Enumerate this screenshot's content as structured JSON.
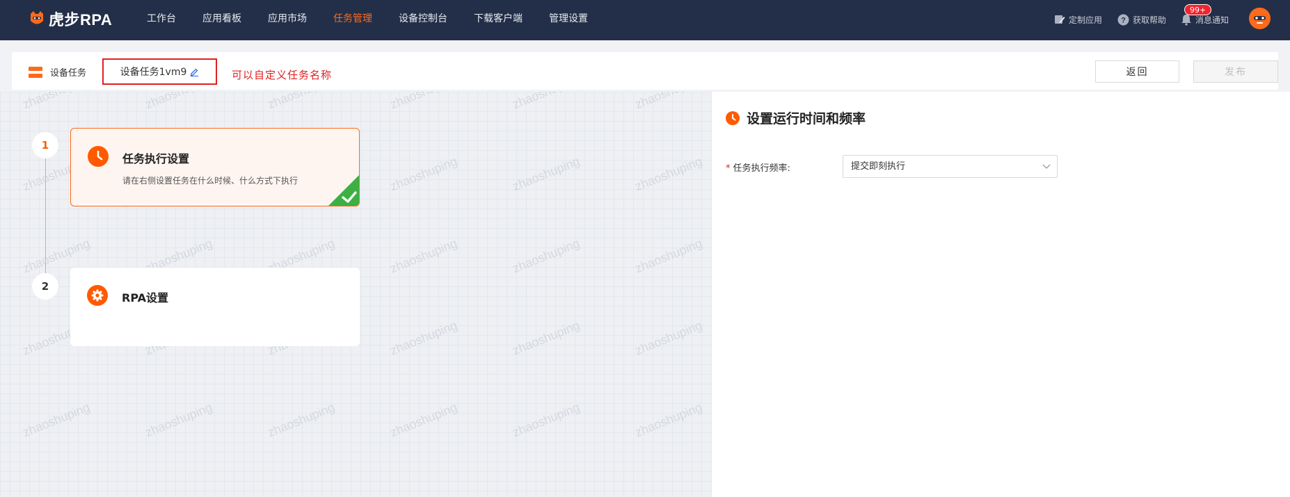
{
  "app": {
    "logo_text": "虎步RPA"
  },
  "nav": {
    "items": [
      {
        "label": "工作台",
        "active": false
      },
      {
        "label": "应用看板",
        "active": false
      },
      {
        "label": "应用市场",
        "active": false
      },
      {
        "label": "任务管理",
        "active": true
      },
      {
        "label": "设备控制台",
        "active": false
      },
      {
        "label": "下载客户端",
        "active": false
      },
      {
        "label": "管理设置",
        "active": false
      }
    ]
  },
  "top_right": {
    "custom_app": "定制应用",
    "help": "获取帮助",
    "notifications": "消息通知",
    "badge": "99+"
  },
  "header": {
    "breadcrumb": "设备任务",
    "task_name": "设备任务1vm9",
    "annotation": "可以自定义任务名称",
    "back_label": "返回",
    "publish_label": "发布"
  },
  "canvas": {
    "watermark": "zhaoshuping",
    "steps": [
      {
        "number": "1",
        "title": "任务执行设置",
        "description": "请在右侧设置任务在什么时候、什么方式下执行",
        "status": "completed"
      },
      {
        "number": "2",
        "title": "RPA设置",
        "description": "",
        "status": "pending"
      }
    ]
  },
  "panel": {
    "title": "设置运行时间和频率",
    "frequency_label": "任务执行频率:",
    "frequency_value": "提交即刻执行"
  },
  "colors": {
    "brand": "#ff6a1a",
    "navbar": "#232f48",
    "annotation": "#e02020"
  }
}
